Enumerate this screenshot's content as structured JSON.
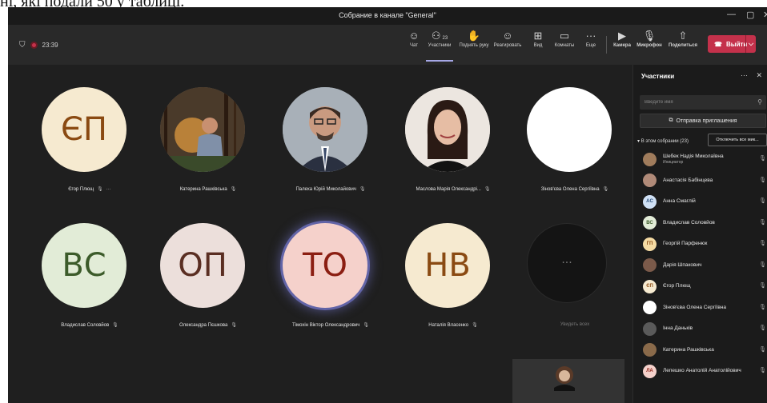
{
  "document_text": "ні, які подали 50 у таблиці.",
  "window": {
    "title": "Собрание в канале \"General\"",
    "controls": [
      "minimize-icon",
      "maximize-icon",
      "close-icon"
    ]
  },
  "meeting": {
    "timer": "23:39"
  },
  "toolbar": {
    "chat": "Чат",
    "participants": "Участники",
    "participants_count": "23",
    "raise_hand": "Поднять руку",
    "react": "Реагировать",
    "view": "Вид",
    "rooms": "Комнаты",
    "more": "Еще",
    "camera": "Камера",
    "mic": "Микрофон",
    "share": "Поделиться",
    "leave": "Выйти"
  },
  "colors": {
    "leave": "#c4314b",
    "speaking_ring": "#6264a7",
    "background": "#1f1f1f"
  },
  "stage": {
    "tiles": [
      {
        "initials": "ЄП",
        "name": "Єгор Плющ",
        "bg": "#f6ead0",
        "fg": "#8a4a12",
        "has_more": true
      },
      {
        "initials": "",
        "name": "Катерина Рашківська",
        "photo": "forest",
        "bg": "#7a6a5a"
      },
      {
        "initials": "",
        "name": "Палеха Юрій Миколайович",
        "photo": "man",
        "bg": "#9aa5b0"
      },
      {
        "initials": "",
        "name": "Маслова Марія Олександрі...",
        "photo": "woman",
        "bg": "#e9e1db"
      },
      {
        "initials": "",
        "name": "Зінов'єва Олена Сергіївна",
        "bg": "#ffffff"
      },
      {
        "initials": "ВС",
        "name": "Владислав Соловйов",
        "bg": "#e2ecd7",
        "fg": "#3c5b2a"
      },
      {
        "initials": "ОП",
        "name": "Олександра Пєшкова",
        "bg": "#ecdfdb",
        "fg": "#5a2e22"
      },
      {
        "initials": "ТО",
        "name": "Тімохін Віктор Олександрович",
        "bg": "#f5d1cb",
        "fg": "#8b1e12",
        "speaking": true
      },
      {
        "initials": "НВ",
        "name": "Наталія Власенко",
        "bg": "#f6ead0",
        "fg": "#8a4a12"
      },
      {
        "initials": "···",
        "name": "Увидеть всех",
        "bg": "#141414",
        "fg": "#777",
        "overflow": true
      }
    ]
  },
  "panel": {
    "title": "Участники",
    "search_placeholder": "Введите имя",
    "invite": "Отправка приглашения",
    "section": "В этом собрании (23)",
    "mute_all": "Отключить все мик...",
    "participants": [
      {
        "name": "Шебек Надія Миколаївна",
        "role": "Инициатор",
        "initials": "",
        "bg": "#a07c5c"
      },
      {
        "name": "Анастасія Бабінцева",
        "initials": "",
        "bg": "#b08a78"
      },
      {
        "name": "Анна Смаглій",
        "initials": "AC",
        "bg": "#cfe0f5",
        "fg": "#2b4f7a"
      },
      {
        "name": "Владислав Соловйов",
        "initials": "ВС",
        "bg": "#e2ecd7",
        "fg": "#3c5b2a"
      },
      {
        "name": "Георгій Парфенюк",
        "initials": "ГП",
        "bg": "#f5dba3",
        "fg": "#8a4a12"
      },
      {
        "name": "Дарія Шпакович",
        "initials": "",
        "bg": "#7b5a4a"
      },
      {
        "name": "Єгор Плющ",
        "initials": "ЄП",
        "bg": "#f6ead0",
        "fg": "#8a4a12"
      },
      {
        "name": "Зінов'єва Олена Сергіївна",
        "initials": "",
        "bg": "#ffffff"
      },
      {
        "name": "Інна Даньків",
        "initials": "",
        "bg": "#5a5a5a"
      },
      {
        "name": "Катерина Рашківська",
        "initials": "",
        "bg": "#8a6a4a"
      },
      {
        "name": "Лепешко Анатолій Анатолійович",
        "initials": "ЛА",
        "bg": "#f5d1cb",
        "fg": "#8b1e12"
      }
    ]
  }
}
